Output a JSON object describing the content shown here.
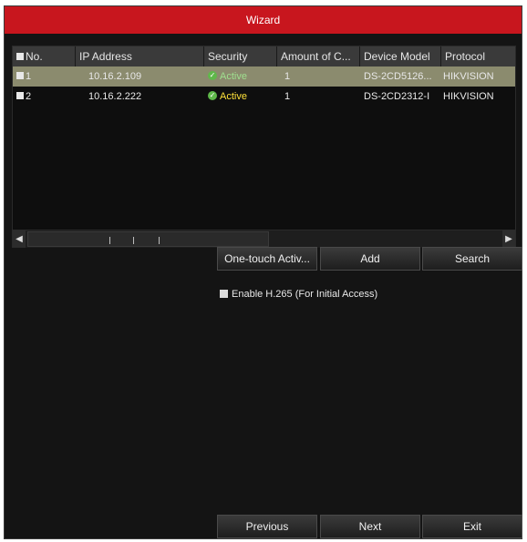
{
  "window": {
    "title": "Wizard"
  },
  "table": {
    "columns": [
      "No.",
      "IP Address",
      "Security",
      "Amount of C...",
      "Device Model",
      "Protocol"
    ],
    "rows": [
      {
        "no": "1",
        "ip": "10.16.2.109",
        "security": "Active",
        "amount": "1",
        "model": "DS-2CD5126...",
        "protocol": "HIKVISION",
        "selected": true
      },
      {
        "no": "2",
        "ip": "10.16.2.222",
        "security": "Active",
        "amount": "1",
        "model": "DS-2CD2312-I",
        "protocol": "HIKVISION",
        "selected": false
      }
    ]
  },
  "actions": {
    "one_touch": "One-touch Activ...",
    "add": "Add",
    "search": "Search"
  },
  "options": {
    "enable_h265": "Enable H.265 (For Initial Access)"
  },
  "footer": {
    "previous": "Previous",
    "next": "Next",
    "exit": "Exit"
  },
  "colors": {
    "title_bar": "#c8161e",
    "selected_row": "#8b8b6e",
    "active_yellow": "#ffe23a",
    "active_green": "#9fe08f"
  }
}
